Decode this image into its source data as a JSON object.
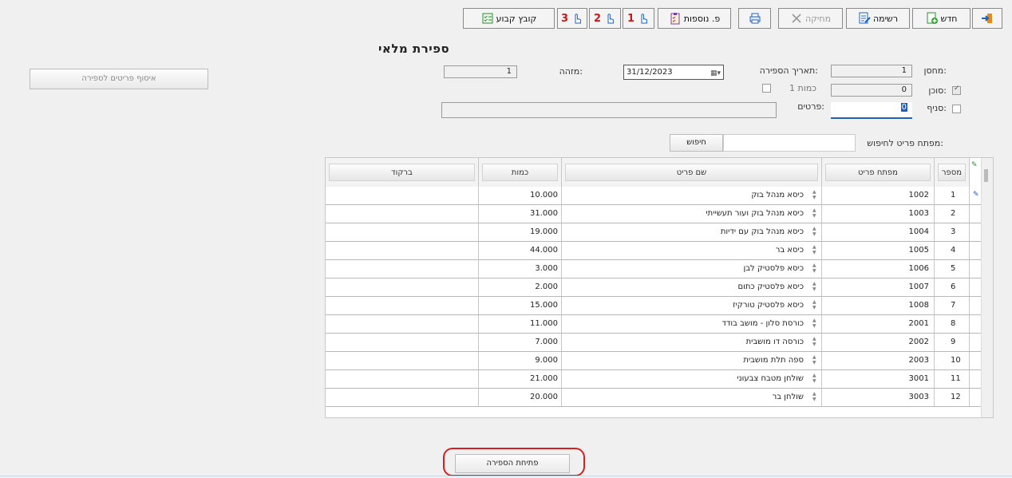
{
  "toolbar": {
    "exit_label": "",
    "new_label": "חדש",
    "list_label": "רשימה",
    "delete_label": "מחיקה",
    "print_label": "",
    "extra_fields_label": "פ. נוספות",
    "hand1_label": "1",
    "hand2_label": "2",
    "hand3_label": "3",
    "fixed_file_label": "קובץ קבוע"
  },
  "page_title": "ספירת מלאי",
  "form": {
    "warehouse_label": "מחסן:",
    "warehouse_value": "1",
    "agent_label": "סוכן:",
    "agent_value": "0",
    "branch_label": "סניף:",
    "branch_value": "0",
    "count_date_label": "תאריך הספירה:",
    "count_date_value": "31/12/2023",
    "qty1_label": "כמות 1",
    "id_label": "מזהה:",
    "id_value": "1",
    "details_label": "פרטים:",
    "details_value": "",
    "collect_items_label": "איסוף פריטים לספירה",
    "search_key_label": "מפתח פריט לחיפוש:",
    "search_value": "",
    "search_button": "חיפוש"
  },
  "table": {
    "columns": [
      "מספר",
      "מפתח פריט",
      "שם פריט",
      "כמות",
      "ברקוד"
    ],
    "rows": [
      {
        "num": "1",
        "key": "1002",
        "name": "כיסא מנהל בוק",
        "qty": "10.000",
        "barcode": ""
      },
      {
        "num": "2",
        "key": "1003",
        "name": "כיסא מנהל בוק ועור תעשייתי",
        "qty": "31.000",
        "barcode": ""
      },
      {
        "num": "3",
        "key": "1004",
        "name": "כיסא מנהל בוק עם ידיות",
        "qty": "19.000",
        "barcode": ""
      },
      {
        "num": "4",
        "key": "1005",
        "name": "כיסא בר",
        "qty": "44.000",
        "barcode": ""
      },
      {
        "num": "5",
        "key": "1006",
        "name": "כיסא פלסטיק לבן",
        "qty": "3.000",
        "barcode": ""
      },
      {
        "num": "6",
        "key": "1007",
        "name": "כיסא פלסטיק כתום",
        "qty": "2.000",
        "barcode": ""
      },
      {
        "num": "7",
        "key": "1008",
        "name": "כיסא פלסטיק טורקיז",
        "qty": "15.000",
        "barcode": ""
      },
      {
        "num": "8",
        "key": "2001",
        "name": "כורסת סלון - מושב בודד",
        "qty": "11.000",
        "barcode": ""
      },
      {
        "num": "9",
        "key": "2002",
        "name": "כורסה דו מושבית",
        "qty": "7.000",
        "barcode": ""
      },
      {
        "num": "10",
        "key": "2003",
        "name": "ספה תלת מושבית",
        "qty": "9.000",
        "barcode": ""
      },
      {
        "num": "11",
        "key": "3001",
        "name": "שולחן מטבח צבעוני",
        "qty": "21.000",
        "barcode": ""
      },
      {
        "num": "12",
        "key": "3003",
        "name": "שולחן בר",
        "qty": "20.000",
        "barcode": ""
      }
    ]
  },
  "footer": {
    "open_count_label": "פתיחת הספירה"
  },
  "colors": {
    "highlight_ring": "#d62020",
    "accent_blue": "#1f5fbf",
    "hand_number_red": "#d01616"
  }
}
